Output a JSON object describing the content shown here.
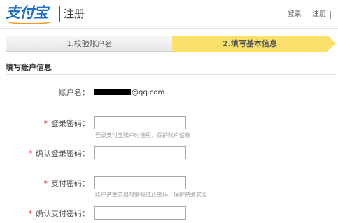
{
  "header": {
    "logo_text": "支付宝",
    "title": "注册",
    "links": {
      "login": "登录",
      "separator": "·",
      "register": "注册"
    }
  },
  "steps": [
    {
      "label": "1.校验账户名",
      "active": false
    },
    {
      "label": "2.填写基本信息",
      "active": true
    }
  ],
  "section": {
    "title": "填写账户信息"
  },
  "form": {
    "account": {
      "label": "账户名：",
      "value_suffix": "@qq.com"
    },
    "login_password": {
      "label": "登录密码：",
      "required": "*",
      "value": "",
      "hint": "登录支付宝账户时使用，保护账户信息"
    },
    "confirm_login_password": {
      "label": "确认登录密码：",
      "required": "*",
      "value": ""
    },
    "pay_password": {
      "label": "支付密码：",
      "required": "*",
      "value": "",
      "hint": "账户资金支出时需验证此密码，保护资金安全"
    },
    "confirm_pay_password": {
      "label": "确认支付密码：",
      "required": "*",
      "value": ""
    }
  },
  "colors": {
    "brand_blue": "#1f6fc6",
    "brand_orange": "#f39a1e",
    "active_step": "#fbe06c",
    "required_star": "#e4393c"
  }
}
